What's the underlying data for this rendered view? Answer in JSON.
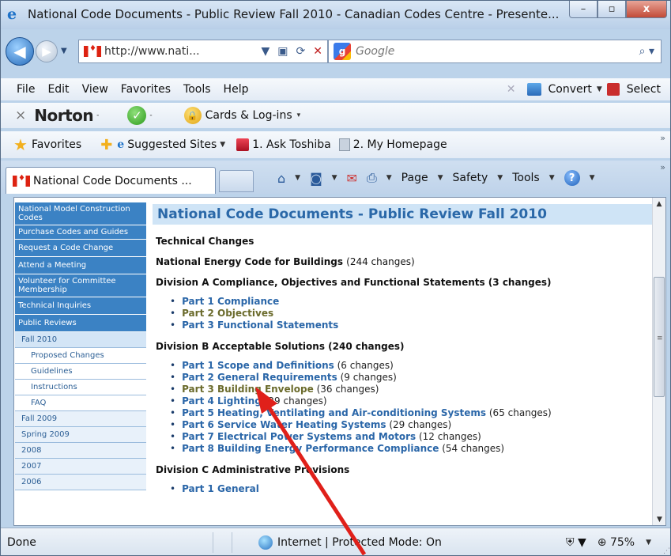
{
  "window": {
    "title": "National Code Documents - Public Review Fall 2010 - Canadian Codes Centre - Presente...",
    "controls": {
      "minimize": "–",
      "maximize": "▫",
      "close": "x"
    }
  },
  "address_bar": {
    "url": "http://www.nati...",
    "search_placeholder": "Google"
  },
  "menu": {
    "items": [
      "File",
      "Edit",
      "View",
      "Favorites",
      "Tools",
      "Help"
    ],
    "convert_label": "Convert",
    "select_label": "Select"
  },
  "norton": {
    "logo": "Norton",
    "cards_label": "Cards & Log-ins"
  },
  "favorites_bar": {
    "favorites_label": "Favorites",
    "items": [
      "Suggested Sites",
      "1. Ask Toshiba",
      "2. My Homepage"
    ]
  },
  "tab": {
    "title": "National Code Documents ..."
  },
  "command_bar": {
    "page": "Page",
    "safety": "Safety",
    "tools": "Tools"
  },
  "sidebar": {
    "items": [
      "National Model Construction Codes",
      "Purchase Codes and Guides",
      "Request a Code Change",
      "Attend a Meeting",
      "Volunteer for Committee Membership",
      "Technical Inquiries",
      "Public Reviews"
    ],
    "sub_items": [
      "Fall 2010"
    ],
    "deep_items": [
      "Proposed Changes",
      "Guidelines",
      "Instructions",
      "FAQ"
    ],
    "other_years": [
      "Fall 2009",
      "Spring 2009",
      "2008",
      "2007",
      "2006"
    ]
  },
  "main": {
    "page_title": "National Code Documents - Public Review Fall 2010",
    "technical_changes": "Technical Changes",
    "energy_code": "National Energy Code for Buildings",
    "energy_code_count": "(244 changes)",
    "div_a": "Division A Compliance, Objectives and Functional Statements (3 changes)",
    "div_a_items": [
      "Part 1 Compliance",
      "Part 2 Objectives",
      "Part 3 Functional Statements"
    ],
    "div_b": "Division B Acceptable Solutions (240 changes)",
    "div_b_items": [
      {
        "label": "Part 1 Scope and Definitions",
        "count": "(6 changes)"
      },
      {
        "label": "Part 2 General Requirements",
        "count": "(9 changes)"
      },
      {
        "label": "Part 3 Building Envelope",
        "count": "(36 changes)"
      },
      {
        "label": "Part 4 Lighting",
        "count": "(29 changes)"
      },
      {
        "label": "Part 5 Heating, Ventilating and Air-conditioning Systems",
        "count": "(65 changes)"
      },
      {
        "label": "Part 6 Service Water Heating Systems",
        "count": "(29 changes)"
      },
      {
        "label": "Part 7 Electrical Power Systems and Motors",
        "count": "(12 changes)"
      },
      {
        "label": "Part 8 Building Energy Performance Compliance",
        "count": "(54 changes)"
      }
    ],
    "div_c": "Division C Administrative Provisions",
    "div_c_items": [
      "Part 1 General"
    ]
  },
  "status_bar": {
    "status": "Done",
    "zone": "Internet | Protected Mode: On",
    "zoom": "75%"
  },
  "colors": {
    "sidebar_blue": "#3b82c4",
    "title_band": "#cfe4f6",
    "link": "#2a66a8",
    "visited_link": "#6b6b2c",
    "annotation_arrow": "#e0201a"
  }
}
